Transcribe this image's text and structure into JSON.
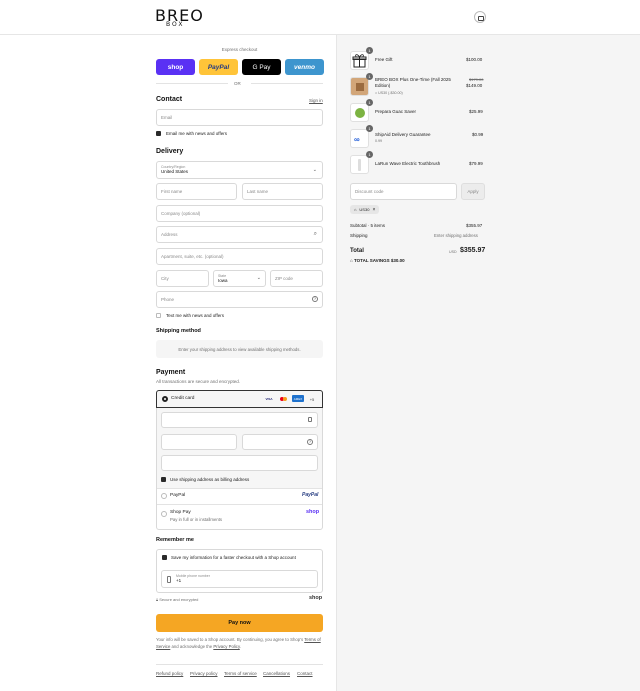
{
  "header": {
    "logo_top": "BREO",
    "logo_sub": "BOX",
    "bag_icon": "shopping-bag-icon"
  },
  "express": {
    "title": "Express checkout",
    "buttons": [
      "shop",
      "PayPal",
      "G Pay",
      "venmo"
    ],
    "or": "OR"
  },
  "contact": {
    "title": "Contact",
    "sign_in": "Sign in",
    "email_placeholder": "Email",
    "email_news": "Email me with news and offers"
  },
  "delivery": {
    "title": "Delivery",
    "country_label": "Country/Region",
    "country_value": "United States",
    "first_name": "First name",
    "last_name": "Last name",
    "company": "Company (optional)",
    "address": "Address",
    "apartment": "Apartment, suite, etc. (optional)",
    "city": "City",
    "state_label": "State",
    "state_value": "Iowa",
    "zip": "ZIP code",
    "phone": "Phone",
    "text_news": "Text me with news and offers"
  },
  "shipping_method": {
    "title": "Shipping method",
    "note": "Enter your shipping address to view available shipping methods."
  },
  "payment": {
    "title": "Payment",
    "subtitle": "All transactions are secure and encrypted.",
    "credit_card": "Credit card",
    "card_more": "+5",
    "billing_same": "Use shipping address as billing address",
    "paypal": "PayPal",
    "paypal_logo": "PayPal",
    "shop_pay": "Shop Pay",
    "shop_pay_sub": "Pay in full or in installments",
    "shop_logo": "shop"
  },
  "remember": {
    "title": "Remember me",
    "save_info": "Save my information for a faster checkout with a Shop account",
    "mobile_label": "Mobile phone number",
    "mobile_value": "+1",
    "secure": "Secure and encrypted",
    "shop_logo": "shop"
  },
  "pay_now": "Pay now",
  "disclaimer": {
    "text1": "Your info will be saved to a Shop account. By continuing, you agree to Shop's",
    "terms": "Terms of Service",
    "and": " and acknowledge the ",
    "privacy": "Privacy Policy",
    "period": "."
  },
  "footer": [
    "Refund policy",
    "Privacy policy",
    "Terms of service",
    "Cancellations",
    "Contact"
  ],
  "order": {
    "items": [
      {
        "qty": "1",
        "name": "Free Gift",
        "price": "$100.00",
        "icon": "gift-icon"
      },
      {
        "qty": "1",
        "name": "BREO BOX Plus One-Time (Fall 2025 Edition)",
        "old_price": "$179.00",
        "price": "$149.00",
        "discount": "US30 (-$30.00)"
      },
      {
        "qty": "1",
        "name": "Prepara Guac Saver",
        "price": "$25.99"
      },
      {
        "qty": "1",
        "name": "ShipAid Delivery Guarantee",
        "sub": "0.99",
        "price": "$0.99"
      },
      {
        "qty": "1",
        "name": "LaRun Wave Electric Toothbrush",
        "price": "$79.99"
      }
    ],
    "discount_placeholder": "Discount code",
    "apply": "Apply",
    "code_tag": "US30",
    "subtotal_label": "Subtotal · 5 items",
    "subtotal_value": "$355.97",
    "shipping_label": "Shipping",
    "shipping_value": "Enter shipping address",
    "total_label": "Total",
    "currency": "USD",
    "total_value": "$355.97",
    "savings_label": "TOTAL SAVINGS",
    "savings_value": "$30.00"
  }
}
